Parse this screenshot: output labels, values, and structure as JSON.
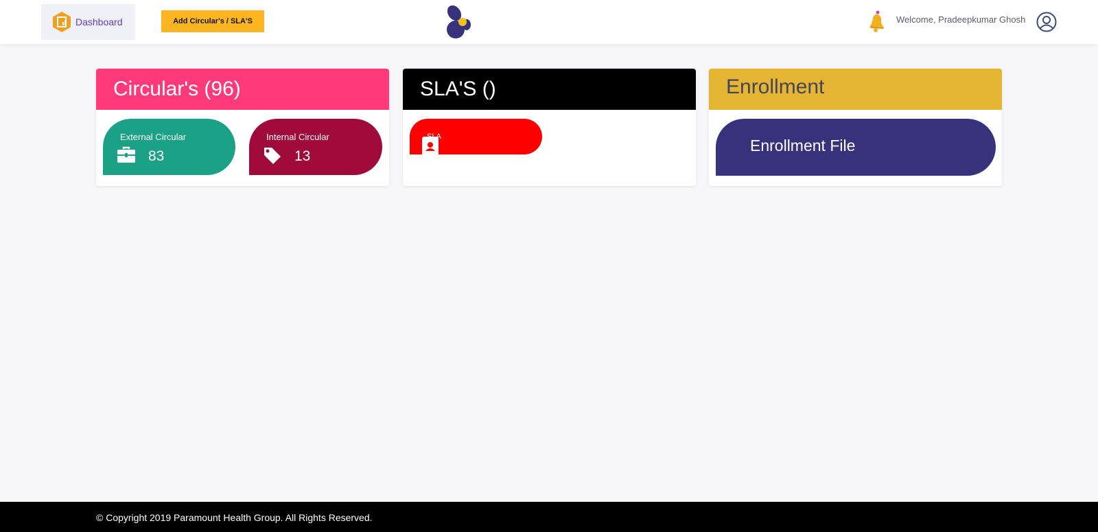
{
  "header": {
    "dashboard_label": "Dashboard",
    "add_button_label": "Add Circular's / SLA'S",
    "welcome_text": "Welcome, Pradeepkumar Ghosh"
  },
  "cards": {
    "circulars": {
      "title": "Circular's (96)",
      "color": "#ff3a7a",
      "tiles": [
        {
          "label": "External Circular",
          "value": "83",
          "icon": "briefcase-icon",
          "color": "#1ba186"
        },
        {
          "label": "Internal Circular",
          "value": "13",
          "icon": "tag-icon",
          "color": "#a00a3a"
        }
      ]
    },
    "slas": {
      "title": "SLA'S ()",
      "color": "#000000",
      "tile": {
        "label": "SLA",
        "icon": "user-badge-icon",
        "color": "#ff0000"
      }
    },
    "enrollment": {
      "title": "Enrollment",
      "color": "#e5b432",
      "tile": {
        "label": "Enrollment File",
        "color": "#38327c"
      }
    }
  },
  "footer": {
    "copyright": "© Copyright 2019 Paramount Health Group. All Rights Reserved."
  }
}
